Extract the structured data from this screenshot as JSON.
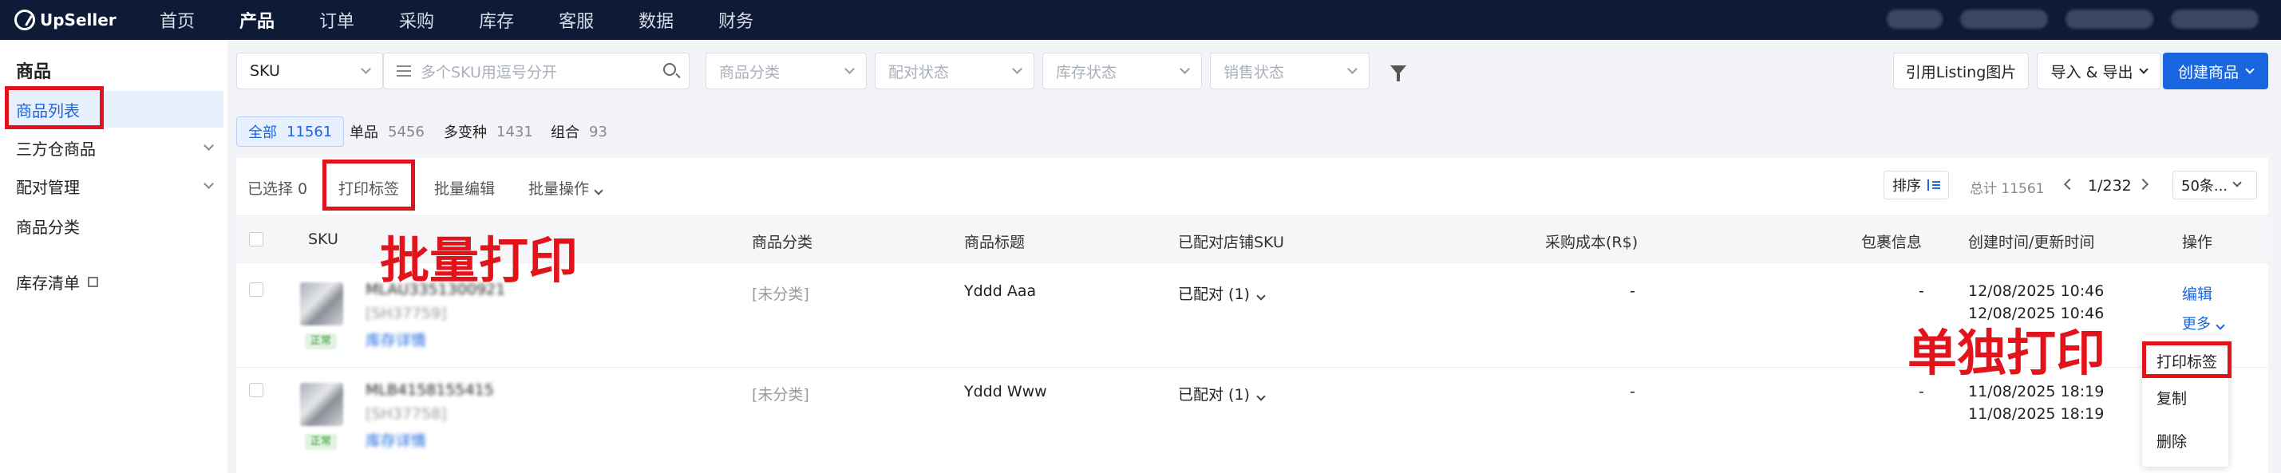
{
  "topnav": {
    "logo": "UpSeller",
    "items": [
      "首页",
      "产品",
      "订单",
      "采购",
      "库存",
      "客服",
      "数据",
      "财务"
    ],
    "active_index": 1
  },
  "sidebar": {
    "title": "商品",
    "items": [
      {
        "label": "商品列表",
        "active": true
      },
      {
        "label": "三方仓商品",
        "expandable": true
      },
      {
        "label": "配对管理",
        "expandable": true
      },
      {
        "label": "商品分类"
      },
      {
        "label": "库存清单",
        "external": true
      }
    ]
  },
  "filters": {
    "sku_select": "SKU",
    "search_placeholder": "多个SKU用逗号分开",
    "category_placeholder": "商品分类",
    "pair_status_placeholder": "配对状态",
    "stock_status_placeholder": "库存状态",
    "sale_status_placeholder": "销售状态"
  },
  "actions": {
    "listing_images": "引用Listing图片",
    "import_export": "导入 & 导出",
    "create": "创建商品"
  },
  "tabs": [
    {
      "label": "全部",
      "count": "11561",
      "active": true
    },
    {
      "label": "单品",
      "count": "5456"
    },
    {
      "label": "多变种",
      "count": "1431"
    },
    {
      "label": "组合",
      "count": "93"
    }
  ],
  "toolbar": {
    "selected": "已选择 0",
    "print_label": "打印标签",
    "batch_edit": "批量编辑",
    "batch_ops": "批量操作",
    "sort": "排序",
    "total": "总计 11561",
    "page": "1/232",
    "page_size": "50条..."
  },
  "table": {
    "headers": [
      "SKU",
      "商品分类",
      "商品标题",
      "已配对店铺SKU",
      "采购成本(R$)",
      "包裹信息",
      "创建时间/更新时间",
      "操作"
    ],
    "rows": [
      {
        "sku": "MLAU3351300921",
        "sub_sku": "[SH37759]",
        "tag": "正常",
        "stock_detail": "库存详情",
        "category": "[未分类]",
        "title": "Yddd Aaa",
        "paired": "已配对 (1)",
        "cost": "-",
        "package": "-",
        "created": "12/08/2025 10:46",
        "updated": "12/08/2025 10:46",
        "edit": "编辑",
        "more": "更多"
      },
      {
        "sku": "MLB4158155415",
        "sub_sku": "[SH37758]",
        "tag": "正常",
        "stock_detail": "库存详情",
        "category": "[未分类]",
        "title": "Yddd Www",
        "paired": "已配对 (1)",
        "cost": "-",
        "package": "-",
        "created": "11/08/2025 18:19",
        "updated": "11/08/2025 18:19"
      }
    ]
  },
  "more_menu": [
    "打印标签",
    "复制",
    "删除"
  ],
  "annotations": {
    "batch_print": "批量打印",
    "single_print": "单独打印"
  },
  "colors": {
    "nav_bg": "#0d1b36",
    "primary": "#1a66e0",
    "highlight_red": "#e3131b",
    "success": "#3a9a3a"
  }
}
